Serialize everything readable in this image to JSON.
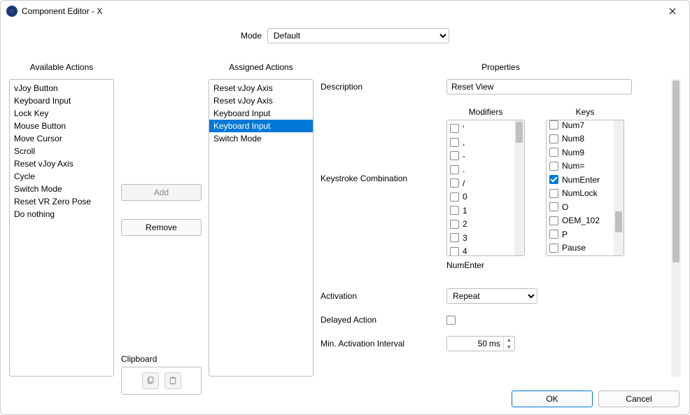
{
  "window": {
    "title": "Component Editor - X"
  },
  "mode": {
    "label": "Mode",
    "value": "Default"
  },
  "headers": {
    "available": "Available Actions",
    "assigned": "Assigned Actions",
    "properties": "Properties"
  },
  "available_actions": [
    "vJoy Button",
    "Keyboard Input",
    "Lock Key",
    "Mouse Button",
    "Move Cursor",
    "Scroll",
    "Reset vJoy Axis",
    "Cycle",
    "Switch Mode",
    "Reset VR Zero Pose",
    "Do nothing"
  ],
  "assigned_actions": [
    {
      "label": "Reset vJoy Axis",
      "selected": false
    },
    {
      "label": "Reset vJoy Axis",
      "selected": false
    },
    {
      "label": "Keyboard Input",
      "selected": false
    },
    {
      "label": "Keyboard Input",
      "selected": true
    },
    {
      "label": "Switch Mode",
      "selected": false
    }
  ],
  "buttons": {
    "add": "Add",
    "remove": "Remove",
    "clipboard_label": "Clipboard",
    "ok": "OK",
    "cancel": "Cancel"
  },
  "properties": {
    "description_label": "Description",
    "description_value": "Reset View",
    "keystroke_label": "Keystroke Combination",
    "modifiers_head": "Modifiers",
    "keys_head": "Keys",
    "modifiers": [
      {
        "label": "'",
        "checked": false
      },
      {
        "label": ",",
        "checked": false
      },
      {
        "label": "-",
        "checked": false
      },
      {
        "label": ".",
        "checked": false
      },
      {
        "label": "/",
        "checked": false
      },
      {
        "label": "0",
        "checked": false
      },
      {
        "label": "1",
        "checked": false
      },
      {
        "label": "2",
        "checked": false
      },
      {
        "label": "3",
        "checked": false
      },
      {
        "label": "4",
        "checked": false
      }
    ],
    "keys": [
      {
        "label": "Num7",
        "checked": false
      },
      {
        "label": "Num8",
        "checked": false
      },
      {
        "label": "Num9",
        "checked": false
      },
      {
        "label": "Num=",
        "checked": false
      },
      {
        "label": "NumEnter",
        "checked": true
      },
      {
        "label": "NumLock",
        "checked": false
      },
      {
        "label": "O",
        "checked": false
      },
      {
        "label": "OEM_102",
        "checked": false
      },
      {
        "label": "P",
        "checked": false
      },
      {
        "label": "Pause",
        "checked": false
      }
    ],
    "summary": "NumEnter",
    "activation_label": "Activation",
    "activation_value": "Repeat",
    "delayed_label": "Delayed Action",
    "delayed_checked": false,
    "min_interval_label": "Min. Activation Interval",
    "min_interval_value": "50",
    "min_interval_unit": "ms"
  }
}
